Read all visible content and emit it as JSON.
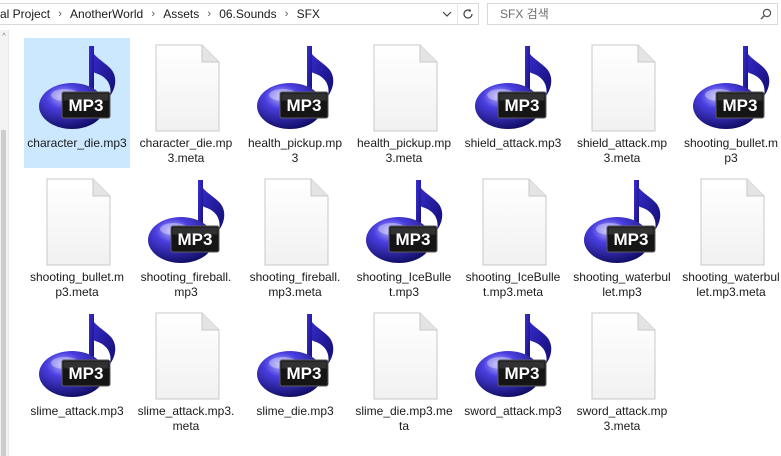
{
  "breadcrumb": {
    "segments": [
      "al Project",
      "AnotherWorld",
      "Assets",
      "06.Sounds",
      "SFX"
    ],
    "separator": "›",
    "dropdown_icon": "chevron-down-icon",
    "refresh_icon": "refresh-icon"
  },
  "search": {
    "placeholder": "SFX 검색",
    "icon": "search-icon"
  },
  "colors": {
    "selection": "#cce8ff",
    "note_blue": "#2a1fb8",
    "note_dark": "#14107a"
  },
  "files": [
    {
      "name": "character_die.mp3",
      "type": "mp3",
      "selected": true
    },
    {
      "name": "character_die.mp3.meta",
      "type": "meta"
    },
    {
      "name": "health_pickup.mp3",
      "type": "mp3"
    },
    {
      "name": "health_pickup.mp3.meta",
      "type": "meta"
    },
    {
      "name": "shield_attack.mp3",
      "type": "mp3"
    },
    {
      "name": "shield_attack.mp3.meta",
      "type": "meta"
    },
    {
      "name": "shooting_bullet.mp3",
      "type": "mp3"
    },
    {
      "name": "shooting_bullet.mp3.meta",
      "type": "meta"
    },
    {
      "name": "shooting_fireball.mp3",
      "type": "mp3"
    },
    {
      "name": "shooting_fireball.mp3.meta",
      "type": "meta"
    },
    {
      "name": "shooting_IceBullet.mp3",
      "type": "mp3"
    },
    {
      "name": "shooting_IceBullet.mp3.meta",
      "type": "meta"
    },
    {
      "name": "shooting_waterbullet.mp3",
      "type": "mp3"
    },
    {
      "name": "shooting_waterbullet.mp3.meta",
      "type": "meta"
    },
    {
      "name": "slime_attack.mp3",
      "type": "mp3"
    },
    {
      "name": "slime_attack.mp3.meta",
      "type": "meta"
    },
    {
      "name": "slime_die.mp3",
      "type": "mp3"
    },
    {
      "name": "slime_die.mp3.meta",
      "type": "meta"
    },
    {
      "name": "sword_attack.mp3",
      "type": "mp3"
    },
    {
      "name": "sword_attack.mp3.meta",
      "type": "meta"
    }
  ],
  "mp3_badge_label": "MP3"
}
